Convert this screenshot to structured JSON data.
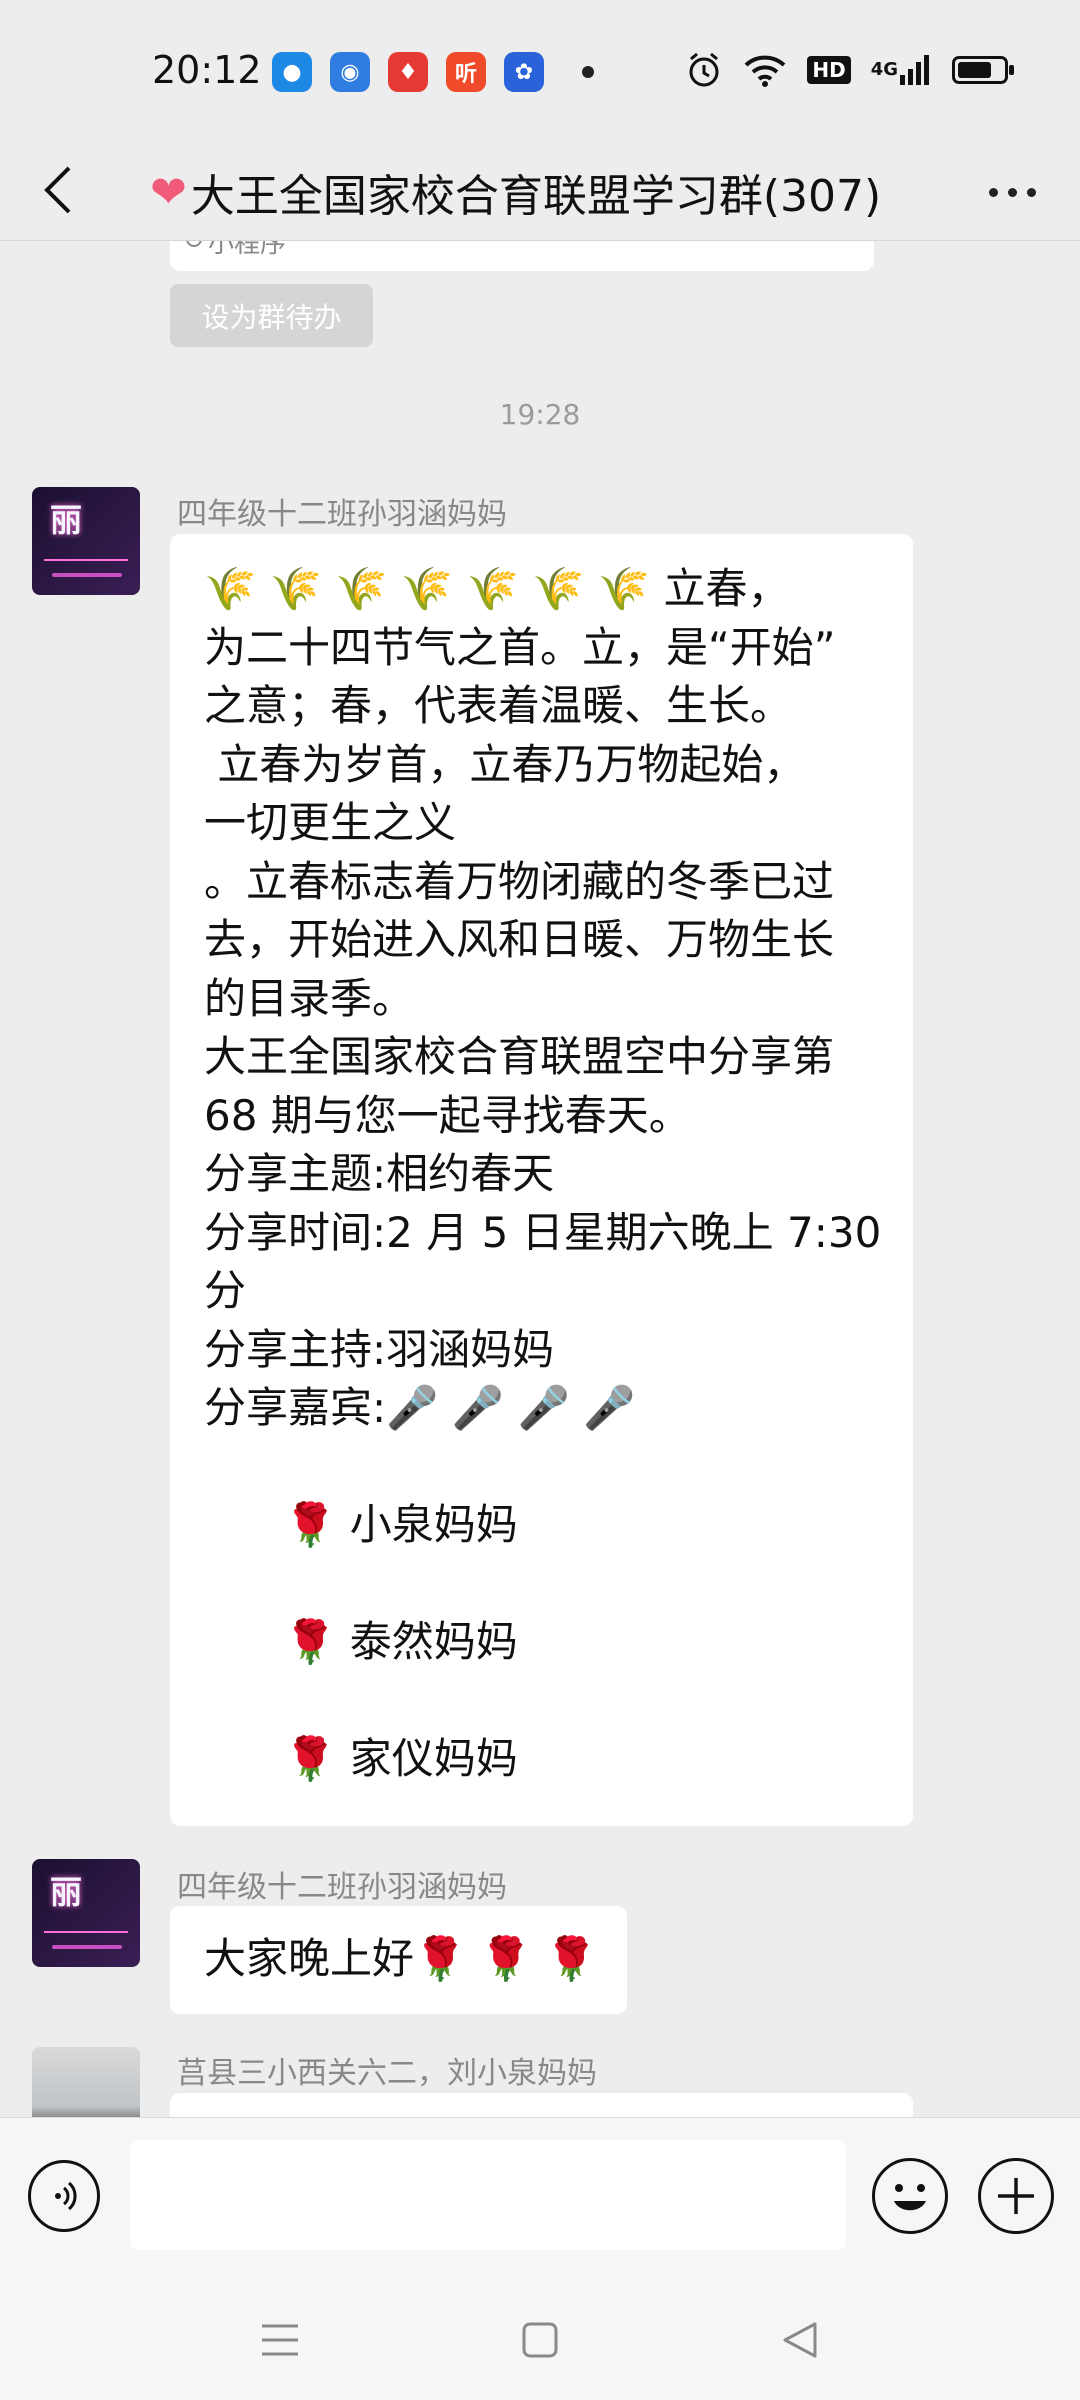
{
  "status_bar": {
    "time": "20:12",
    "app_icons": [
      {
        "name": "blue-circle-app-icon",
        "color": "#1e88e5",
        "glyph": "●"
      },
      {
        "name": "map-app-icon",
        "color": "#2f7de1",
        "glyph": "◉"
      },
      {
        "name": "location-app-icon",
        "color": "#e53935",
        "glyph": "♦"
      },
      {
        "name": "listen-app-icon",
        "color": "#ef4b2a",
        "glyph": "听"
      },
      {
        "name": "baidu-app-icon",
        "color": "#2a62d9",
        "glyph": "✿"
      }
    ],
    "hd_label": "HD",
    "network_label": "4G",
    "battery_level": 0.75
  },
  "header": {
    "heart": "❤",
    "title": "大王全国家校合育联盟学习群(307)"
  },
  "chat": {
    "mini_program_label": "小程序",
    "todo_button_label": "设为群待办",
    "time_divider": "19:28",
    "messages": [
      {
        "sender": "四年级十二班孙羽涵妈妈",
        "avatar_text": "丽",
        "lines": [
          "🌾 🌾 🌾 🌾 🌾 🌾 🌾 立春，",
          "为二十四节气之首。立，是“开始”",
          "之意；春，代表着温暖、生长。",
          " 立春为岁首，立春乃万物起始，",
          "一切更生之义",
          "。立春标志着万物闭藏的冬季已过",
          "去，开始进入风和日暖、万物生长",
          "的目录季。",
          "大王全国家校合育联盟空中分享第",
          "68 期与您一起寻找春天。",
          "分享主题:相约春天",
          "分享时间:2 月 5 日星期六晚上 7:30",
          "分",
          "分享主持:羽涵妈妈",
          "分享嘉宾:🎤 🎤 🎤 🎤",
          "",
          "      🌹 小泉妈妈",
          "",
          "      🌹 泰然妈妈",
          "",
          "      🌹 家仪妈妈"
        ]
      },
      {
        "sender": "四年级十二班孙羽涵妈妈",
        "avatar_text": "丽",
        "lines": [
          "大家晚上好🌹 🌹 🌹"
        ]
      },
      {
        "sender": "莒县三小西关六二，刘小泉妈妈",
        "lines": []
      }
    ]
  },
  "input_bar": {
    "placeholder": ""
  }
}
